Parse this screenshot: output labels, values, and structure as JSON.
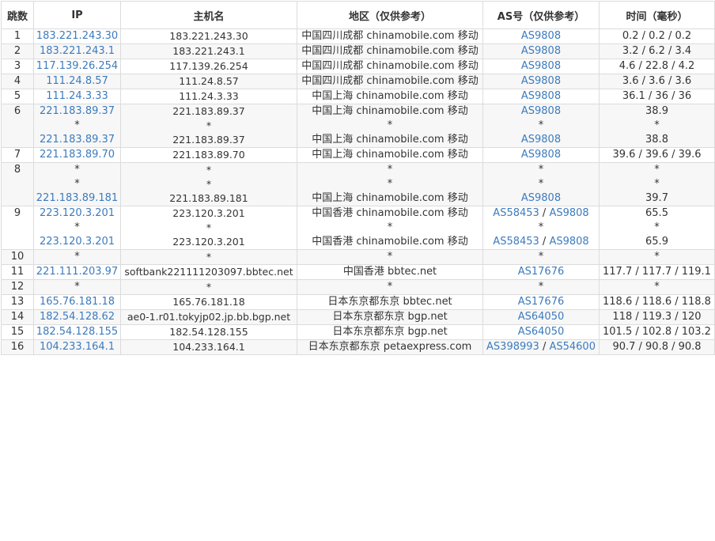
{
  "columns": [
    "跳数",
    "IP",
    "主机名",
    "地区（仅供参考）",
    "AS号（仅供参考）",
    "时间（毫秒）"
  ],
  "rows": [
    {
      "hop": "1",
      "ip": [
        "183.221.243.30"
      ],
      "host": [
        "183.221.243.30"
      ],
      "region": [
        "中国四川成都 chinamobile.com 移动"
      ],
      "as": [
        [
          "AS9808"
        ]
      ],
      "time": [
        "0.2 / 0.2 / 0.2"
      ]
    },
    {
      "hop": "2",
      "ip": [
        "183.221.243.1"
      ],
      "host": [
        "183.221.243.1"
      ],
      "region": [
        "中国四川成都 chinamobile.com 移动"
      ],
      "as": [
        [
          "AS9808"
        ]
      ],
      "time": [
        "3.2 / 6.2 / 3.4"
      ]
    },
    {
      "hop": "3",
      "ip": [
        "117.139.26.254"
      ],
      "host": [
        "117.139.26.254"
      ],
      "region": [
        "中国四川成都 chinamobile.com 移动"
      ],
      "as": [
        [
          "AS9808"
        ]
      ],
      "time": [
        "4.6 / 22.8 / 4.2"
      ]
    },
    {
      "hop": "4",
      "ip": [
        "111.24.8.57"
      ],
      "host": [
        "111.24.8.57"
      ],
      "region": [
        "中国四川成都 chinamobile.com 移动"
      ],
      "as": [
        [
          "AS9808"
        ]
      ],
      "time": [
        "3.6 / 3.6 / 3.6"
      ]
    },
    {
      "hop": "5",
      "ip": [
        "111.24.3.33"
      ],
      "host": [
        "111.24.3.33"
      ],
      "region": [
        "中国上海 chinamobile.com 移动"
      ],
      "as": [
        [
          "AS9808"
        ]
      ],
      "time": [
        "36.1 / 36 / 36"
      ]
    },
    {
      "hop": "6",
      "ip": [
        "221.183.89.37",
        "*",
        "221.183.89.37"
      ],
      "host": [
        "221.183.89.37",
        "*",
        "221.183.89.37"
      ],
      "region": [
        "中国上海 chinamobile.com 移动",
        "*",
        "中国上海 chinamobile.com 移动"
      ],
      "as": [
        [
          "AS9808"
        ],
        [
          "*"
        ],
        [
          "AS9808"
        ]
      ],
      "time": [
        "38.9",
        "*",
        "38.8"
      ]
    },
    {
      "hop": "7",
      "ip": [
        "221.183.89.70"
      ],
      "host": [
        "221.183.89.70"
      ],
      "region": [
        "中国上海 chinamobile.com 移动"
      ],
      "as": [
        [
          "AS9808"
        ]
      ],
      "time": [
        "39.6 / 39.6 / 39.6"
      ]
    },
    {
      "hop": "8",
      "ip": [
        "*",
        "*",
        "221.183.89.181"
      ],
      "host": [
        "*",
        "*",
        "221.183.89.181"
      ],
      "region": [
        "*",
        "*",
        "中国上海 chinamobile.com 移动"
      ],
      "as": [
        [
          "*"
        ],
        [
          "*"
        ],
        [
          "AS9808"
        ]
      ],
      "time": [
        "*",
        "*",
        "39.7"
      ]
    },
    {
      "hop": "9",
      "ip": [
        "223.120.3.201",
        "*",
        "223.120.3.201"
      ],
      "host": [
        "223.120.3.201",
        "*",
        "223.120.3.201"
      ],
      "region": [
        "中国香港 chinamobile.com 移动",
        "*",
        "中国香港 chinamobile.com 移动"
      ],
      "as": [
        [
          "AS58453",
          "AS9808"
        ],
        [
          "*"
        ],
        [
          "AS58453",
          "AS9808"
        ]
      ],
      "time": [
        "65.5",
        "*",
        "65.9"
      ]
    },
    {
      "hop": "10",
      "ip": [
        "*"
      ],
      "host": [
        "*"
      ],
      "region": [
        "*"
      ],
      "as": [
        [
          "*"
        ]
      ],
      "time": [
        "*"
      ]
    },
    {
      "hop": "11",
      "ip": [
        "221.111.203.97"
      ],
      "host": [
        "softbank221111203097.bbtec.net"
      ],
      "region": [
        "中国香港 bbtec.net"
      ],
      "as": [
        [
          "AS17676"
        ]
      ],
      "time": [
        "117.7 / 117.7 / 119.1"
      ]
    },
    {
      "hop": "12",
      "ip": [
        "*"
      ],
      "host": [
        "*"
      ],
      "region": [
        "*"
      ],
      "as": [
        [
          "*"
        ]
      ],
      "time": [
        "*"
      ]
    },
    {
      "hop": "13",
      "ip": [
        "165.76.181.18"
      ],
      "host": [
        "165.76.181.18"
      ],
      "region": [
        "日本东京都东京 bbtec.net"
      ],
      "as": [
        [
          "AS17676"
        ]
      ],
      "time": [
        "118.6 / 118.6 / 118.8"
      ]
    },
    {
      "hop": "14",
      "ip": [
        "182.54.128.62"
      ],
      "host": [
        "ae0-1.r01.tokyjp02.jp.bb.bgp.net"
      ],
      "region": [
        "日本东京都东京 bgp.net"
      ],
      "as": [
        [
          "AS64050"
        ]
      ],
      "time": [
        "118 / 119.3 / 120"
      ]
    },
    {
      "hop": "15",
      "ip": [
        "182.54.128.155"
      ],
      "host": [
        "182.54.128.155"
      ],
      "region": [
        "日本东京都东京 bgp.net"
      ],
      "as": [
        [
          "AS64050"
        ]
      ],
      "time": [
        "101.5 / 102.8 / 103.2"
      ]
    },
    {
      "hop": "16",
      "ip": [
        "104.233.164.1"
      ],
      "host": [
        "104.233.164.1"
      ],
      "region": [
        "日本东京都东京 petaexpress.com"
      ],
      "as": [
        [
          "AS398993",
          "AS54600"
        ]
      ],
      "time": [
        "90.7 / 90.8 / 90.8"
      ]
    }
  ],
  "as_separator": " / ",
  "colors": {
    "link": "#3c7bbd",
    "border": "#dcdcdc",
    "stripe": "#f7f7f7",
    "text": "#333333"
  }
}
